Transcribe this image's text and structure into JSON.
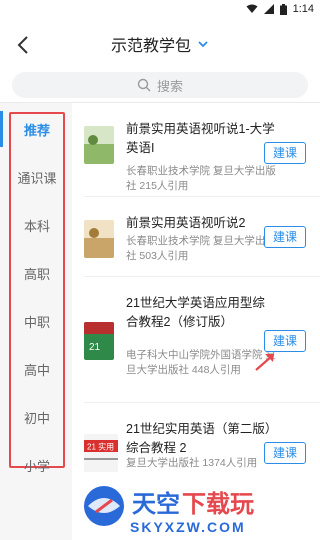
{
  "status_bar": {
    "time": "1:14"
  },
  "header": {
    "title": "示范教学包"
  },
  "search": {
    "placeholder": "搜索"
  },
  "categories": [
    "推荐",
    "通识课",
    "本科",
    "高职",
    "中职",
    "高中",
    "初中",
    "小学"
  ],
  "active_category_index": 0,
  "books": [
    {
      "title": "前景实用英语视听说1-大学英语I",
      "meta": "长春职业技术学院 复旦大学出版社  215人引用",
      "action": "建课"
    },
    {
      "title": "前景实用英语视听说2",
      "meta": "长春职业技术学院 复旦大学出版社  503人引用",
      "action": "建课"
    },
    {
      "title": "21世纪大学英语应用型综合教程2（修订版）",
      "meta": "电子科大中山学院外国语学院 复旦大学出版社  448人引用",
      "action": "建课"
    },
    {
      "title": "21世纪实用英语（第二版）综合教程 2",
      "meta": "复旦大学出版社  1374人引用",
      "action": "建课"
    }
  ],
  "watermark": {
    "text": "天空下载玩",
    "domain": "SKYXZW.COM"
  },
  "colors": {
    "accent": "#2a8ee8",
    "highlight_box": "#e5484d"
  }
}
